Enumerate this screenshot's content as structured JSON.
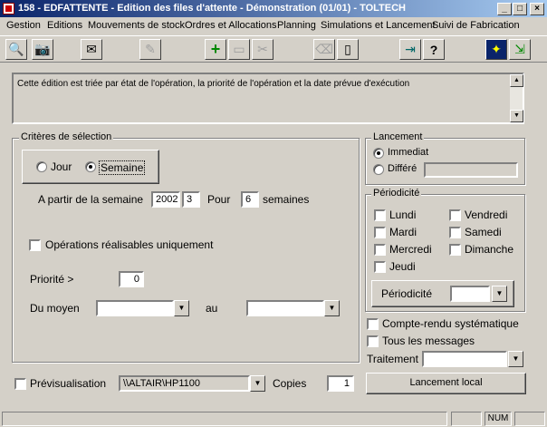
{
  "window": {
    "title": "158 - EDFATTENTE - Edition des files d'attente - Démonstration (01/01) - TOLTECH",
    "controls": {
      "min": "_",
      "max": "□",
      "close": "×"
    }
  },
  "menu": [
    "Gestion",
    "Editions",
    "Mouvements de stock",
    "Ordres et Allocations",
    "Planning",
    "Simulations et Lancement",
    "Suivi de Fabrication"
  ],
  "toolbar": {
    "icons": [
      "preview-icon",
      "camera-icon",
      "mail-icon",
      "edit-icon",
      "add-icon",
      "save-icon",
      "cut-icon",
      "eraser-icon",
      "new-page-icon",
      "export-icon",
      "help-icon",
      "wizard-icon",
      "exit-icon"
    ],
    "glyphs": {
      "preview": "🔍",
      "camera": "📷",
      "mail": "✉",
      "edit": "✎",
      "add": "+",
      "save": "▭",
      "cut": "✂",
      "eraser": "⌫",
      "new_page": "▯",
      "export": "⇥",
      "help": "?",
      "wizard": "✦",
      "exit": "⇲"
    }
  },
  "description": "Cette édition est triée par état de l'opération,  la priorité de l'opération et la date prévue d'exécution",
  "criteres": {
    "title": "Critères de sélection",
    "jour": "Jour",
    "semaine": "Semaine",
    "selected": "Semaine",
    "apartir_label": "A partir de la semaine",
    "year": "2002",
    "week": "3",
    "pour_label": "Pour",
    "count": "6",
    "semaines_label": "semaines",
    "ops_label": "Opérations réalisables uniquement",
    "ops_checked": false,
    "priorite_label": "Priorité >",
    "priorite_value": "0",
    "du_moyen_label": "Du moyen",
    "du_moyen_value": "",
    "au_label": "au",
    "au_value": ""
  },
  "lancement": {
    "title": "Lancement",
    "immediat": "Immediat",
    "differe": "Différé",
    "selected": "Immediat",
    "differe_value": ""
  },
  "periodicite": {
    "title": "Périodicité",
    "days": [
      {
        "label": "Lundi",
        "checked": false
      },
      {
        "label": "Vendredi",
        "checked": false
      },
      {
        "label": "Mardi",
        "checked": false
      },
      {
        "label": "Samedi",
        "checked": false
      },
      {
        "label": "Mercredi",
        "checked": false
      },
      {
        "label": "Dimanche",
        "checked": false
      },
      {
        "label": "Jeudi",
        "checked": false
      }
    ],
    "button": "Périodicité",
    "value": ""
  },
  "options": {
    "compte_rendu": "Compte-rendu systématique",
    "tous_messages": "Tous les messages",
    "traitement_label": "Traitement",
    "traitement_value": ""
  },
  "bottom": {
    "previsu_label": "Prévisualisation",
    "printer": "\\\\ALTAIR\\HP1100",
    "copies_label": "Copies",
    "copies_value": "1",
    "lancement_button": "Lancement local"
  },
  "status": {
    "num": "NUM"
  },
  "colors": {
    "title_start": "#0a246a",
    "title_end": "#a6caf0",
    "face": "#d4d0c8"
  }
}
